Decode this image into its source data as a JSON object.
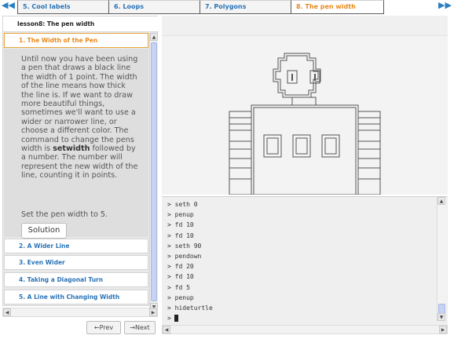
{
  "topnav": {
    "prev_icon": "double-left-arrow-icon",
    "next_icon": "double-right-arrow-icon",
    "tabs": [
      {
        "label": "5. Cool labels",
        "active": false
      },
      {
        "label": "6. Loops",
        "active": false
      },
      {
        "label": "7. Polygons",
        "active": false
      },
      {
        "label": "8. The pen width",
        "active": true
      }
    ]
  },
  "sidebar": {
    "crumb": "lesson8: The pen width",
    "current": {
      "title": "1. The Width of the Pen",
      "text_before": "Until now you have been using a pen that draws a black line the width of 1 point. The width of the line means how thick the line is. If we want to draw more beautiful things, sometimes we'll want to use a wider or narrower line, or choose a different color. The command to change the pens width is ",
      "command": "setwidth",
      "text_after": " followed by a number. The number will represent the new width of the line, counting it in points.",
      "task": "Set the pen width to 5.",
      "solution_label": "Solution"
    },
    "items": [
      {
        "label": "2. A Wider Line"
      },
      {
        "label": "3. Even Wider"
      },
      {
        "label": "4. Taking a Diagonal Turn"
      },
      {
        "label": "5. A Line with Changing Width"
      }
    ],
    "prev_label": "←Prev",
    "next_label": "→Next"
  },
  "console": {
    "prompt": ">",
    "lines": [
      "seth 0",
      "penup",
      "fd 10",
      "fd 10",
      "seth 90",
      "pendown",
      "fd 20",
      "fd 10",
      "fd 5",
      "penup",
      "hideturtle"
    ]
  },
  "colors": {
    "tab_link": "#2a73b6",
    "tab_active": "#e8891d",
    "drawing_line": "#555555"
  }
}
